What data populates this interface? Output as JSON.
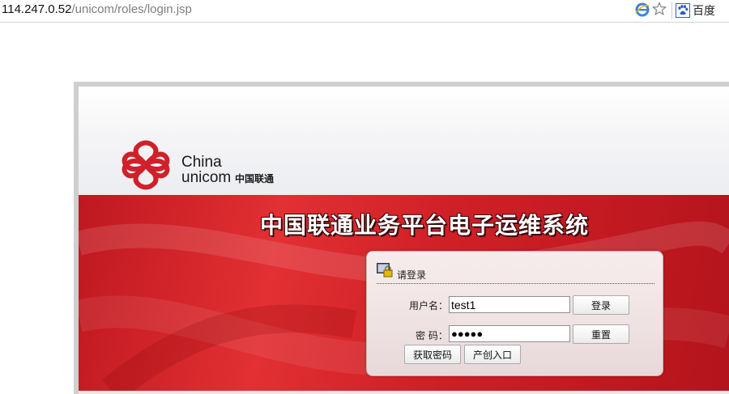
{
  "browser": {
    "url_host": "114.247.0.52",
    "url_path": "/unicom/roles/login.jsp",
    "search_engine_label": "百度"
  },
  "brand": {
    "logo_en_line1": "China",
    "logo_en_line2": "unicom",
    "logo_cn": "中国联通",
    "system_title": "中国联通业务平台电子运维系统",
    "brand_red": "#d0202a"
  },
  "login": {
    "title": "请登录",
    "username_label": "用户名：",
    "username_value": "test1",
    "password_label": "密 码：",
    "password_value": "●●●●●",
    "login_button": "登录",
    "reset_button": "重置",
    "get_password_button": "获取密码",
    "create_entry_button": "产创入口"
  }
}
